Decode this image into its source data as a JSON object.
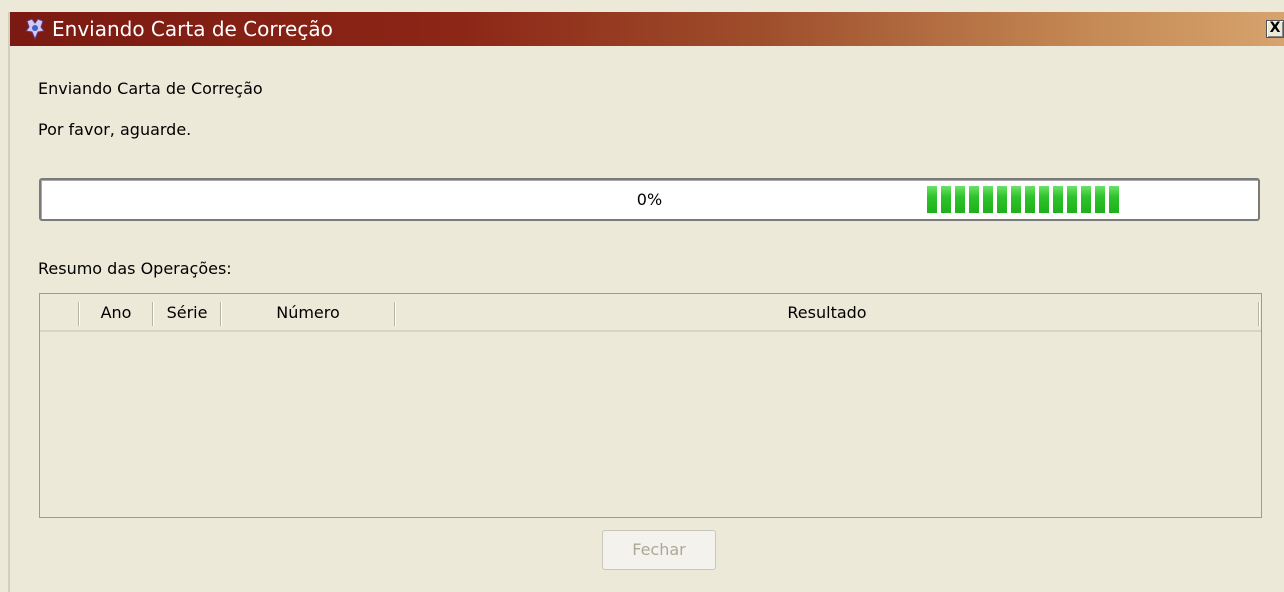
{
  "window": {
    "title": "Enviando Carta de Correção",
    "close_glyph": "✕",
    "close_label": "X"
  },
  "content": {
    "heading": "Enviando Carta de Correção",
    "message": "Por favor, aguarde."
  },
  "progress": {
    "text": "0%",
    "value": 0,
    "marquee_blocks": 14,
    "bar_color": "#2fc32b"
  },
  "summary": {
    "label": "Resumo das Operações:",
    "columns": [
      "",
      "Ano",
      "Série",
      "Número",
      "Resultado"
    ],
    "rows": []
  },
  "footer": {
    "close_button_label": "Fechar",
    "close_button_enabled": false
  },
  "colors": {
    "titlebar_start": "#7b1a12",
    "titlebar_end": "#d7a36e",
    "window_bg": "#ece9d8"
  }
}
